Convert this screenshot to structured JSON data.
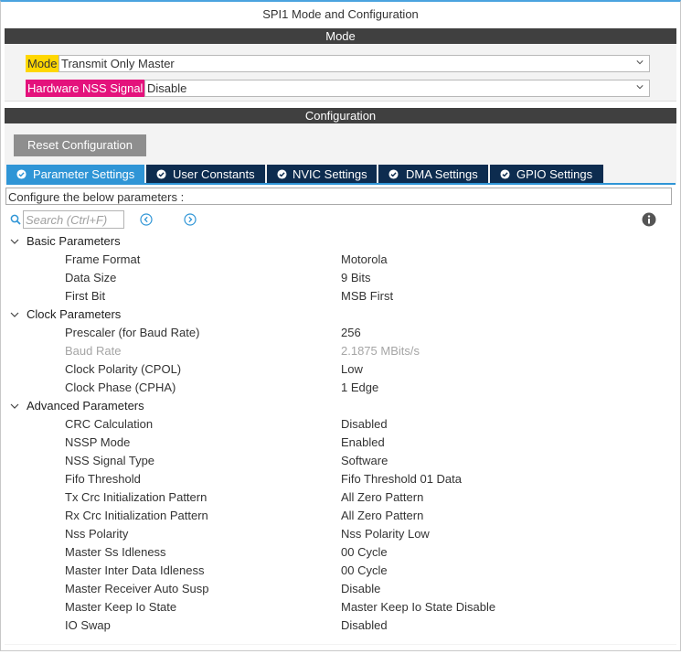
{
  "window": {
    "title": "SPI1 Mode and Configuration"
  },
  "mode_section": {
    "header": "Mode",
    "fields": [
      {
        "label": "Mode",
        "value": "Transmit Only Master",
        "label_bg": "#ffd700"
      },
      {
        "label": "Hardware NSS Signal",
        "value": "Disable",
        "label_bg": "#e4127c"
      }
    ]
  },
  "config_section": {
    "header": "Configuration",
    "reset_label": "Reset Configuration",
    "tabs": [
      {
        "label": "Parameter Settings",
        "active": true
      },
      {
        "label": "User Constants",
        "active": false
      },
      {
        "label": "NVIC Settings",
        "active": false
      },
      {
        "label": "DMA Settings",
        "active": false
      },
      {
        "label": "GPIO Settings",
        "active": false
      }
    ],
    "hint": "Configure the below parameters :",
    "search_placeholder": "Search (Ctrl+F)"
  },
  "groups": [
    {
      "label": "Basic Parameters",
      "params": [
        {
          "name": "Frame Format",
          "value": "Motorola"
        },
        {
          "name": "Data Size",
          "value": "9 Bits"
        },
        {
          "name": "First Bit",
          "value": "MSB First"
        }
      ]
    },
    {
      "label": "Clock Parameters",
      "params": [
        {
          "name": "Prescaler (for Baud Rate)",
          "value": "256"
        },
        {
          "name": "Baud Rate",
          "value": "2.1875 MBits/s",
          "disabled": true
        },
        {
          "name": "Clock Polarity (CPOL)",
          "value": "Low"
        },
        {
          "name": "Clock Phase (CPHA)",
          "value": "1 Edge"
        }
      ]
    },
    {
      "label": "Advanced Parameters",
      "params": [
        {
          "name": "CRC Calculation",
          "value": "Disabled"
        },
        {
          "name": "NSSP Mode",
          "value": "Enabled"
        },
        {
          "name": "NSS Signal Type",
          "value": "Software"
        },
        {
          "name": "Fifo Threshold",
          "value": "Fifo Threshold 01 Data"
        },
        {
          "name": "Tx Crc Initialization Pattern",
          "value": "All Zero Pattern"
        },
        {
          "name": "Rx Crc Initialization Pattern",
          "value": "All Zero Pattern"
        },
        {
          "name": "Nss Polarity",
          "value": "Nss Polarity Low"
        },
        {
          "name": "Master Ss Idleness",
          "value": "00 Cycle"
        },
        {
          "name": "Master Inter Data Idleness",
          "value": "00 Cycle"
        },
        {
          "name": "Master Receiver Auto Susp",
          "value": "Disable"
        },
        {
          "name": "Master Keep Io State",
          "value": "Master Keep Io State Disable"
        },
        {
          "name": "IO Swap",
          "value": "Disabled"
        }
      ]
    }
  ],
  "icons": {
    "search": "search-icon",
    "prev": "arrow-left-circle-icon",
    "next": "arrow-right-circle-icon",
    "info": "info-icon",
    "tab_check": "check-circle-icon",
    "group_toggle": "chevron-down-icon"
  },
  "colors": {
    "accent": "#2f95d6",
    "tab_dark": "#0d2c4f",
    "section_bar": "#404040",
    "mode_label": "#ffd700",
    "nss_label": "#e4127c"
  }
}
